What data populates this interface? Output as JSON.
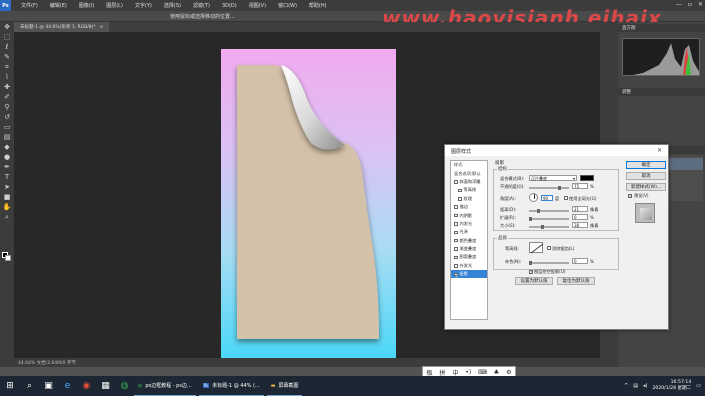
{
  "menubar": {
    "logo": "Ps",
    "items": [
      "文件(F)",
      "编辑(E)",
      "图像(I)",
      "图层(L)",
      "文字(Y)",
      "选择(S)",
      "滤镜(T)",
      "3D(D)",
      "视图(V)",
      "窗口(W)",
      "帮助(H)"
    ]
  },
  "optbar": {
    "text": "使用鼠标或选择移动的位置..."
  },
  "watermark": "www.haoyisianh eihaix",
  "doc_tab": {
    "label": "未标题-1 @ 44.6%(形状 1, RGB/8)*",
    "close": "×"
  },
  "status": {
    "text": "44.64%    文档:2.64M/0 字节"
  },
  "right_panel": {
    "histogram_head": "直方图",
    "row1": "调整",
    "layers_head": "图层",
    "layer_name": "形状 1"
  },
  "dialog": {
    "title": "图层样式",
    "close": "×",
    "style_list": [
      {
        "label": "样式",
        "checked": false,
        "header": true
      },
      {
        "label": "混合选项:默认",
        "checked": false,
        "header": true
      },
      {
        "label": "斜面和浮雕",
        "checked": false
      },
      {
        "label": "等高线",
        "checked": false
      },
      {
        "label": "纹理",
        "checked": false
      },
      {
        "label": "描边",
        "checked": false
      },
      {
        "label": "内阴影",
        "checked": false
      },
      {
        "label": "内发光",
        "checked": false
      },
      {
        "label": "光泽",
        "checked": false
      },
      {
        "label": "颜色叠加",
        "checked": false
      },
      {
        "label": "渐变叠加",
        "checked": false
      },
      {
        "label": "图案叠加",
        "checked": false
      },
      {
        "label": "外发光",
        "checked": false
      },
      {
        "label": "投影",
        "checked": true,
        "selected": true
      }
    ],
    "section_title": "投影",
    "structure_title": "结构",
    "blend_mode_label": "混合模式(B):",
    "blend_mode_value": "正片叠底",
    "opacity_label": "不透明度(O):",
    "opacity_value": "75",
    "angle_label": "角度(A):",
    "angle_value": "90",
    "global_light_label": "使用全局光(G)",
    "distance_label": "距离(D):",
    "distance_value": "21",
    "spread_label": "扩展(R):",
    "spread_value": "0",
    "size_label": "大小(S):",
    "size_value": "38",
    "quality_title": "品质",
    "contour_label": "等高线:",
    "anti_alias_label": "消除锯齿(L)",
    "noise_label": "杂色(N):",
    "noise_value": "0",
    "knockout_label": "图层挖空投影(U)",
    "btn_default": "设置为默认值",
    "btn_reset": "复位为默认值",
    "btn_ok": "确定",
    "btn_cancel": "取消",
    "btn_new_style": "新建样式(W)...",
    "preview_label": "预览(V)",
    "unit_pct": "%",
    "unit_deg": "度",
    "unit_px": "像素"
  },
  "taskbar": {
    "tasks": [
      {
        "label": "ps边框教程 - ps边..."
      },
      {
        "label": "未标题-1 @ 44% (..."
      },
      {
        "label": "屏幕截图"
      }
    ],
    "time": "16:57:14",
    "date": "2020/1/28 星期二"
  },
  "ime": [
    "极",
    "拼",
    "中",
    "•)",
    "⌨",
    "♣",
    "⚙"
  ],
  "colors": {
    "accent": "#3584d6",
    "taskbar": "#1d2733",
    "canvas_top": "#f2aaf0",
    "canvas_bottom": "#4ad8f8",
    "shape": "#d4c1a9"
  }
}
